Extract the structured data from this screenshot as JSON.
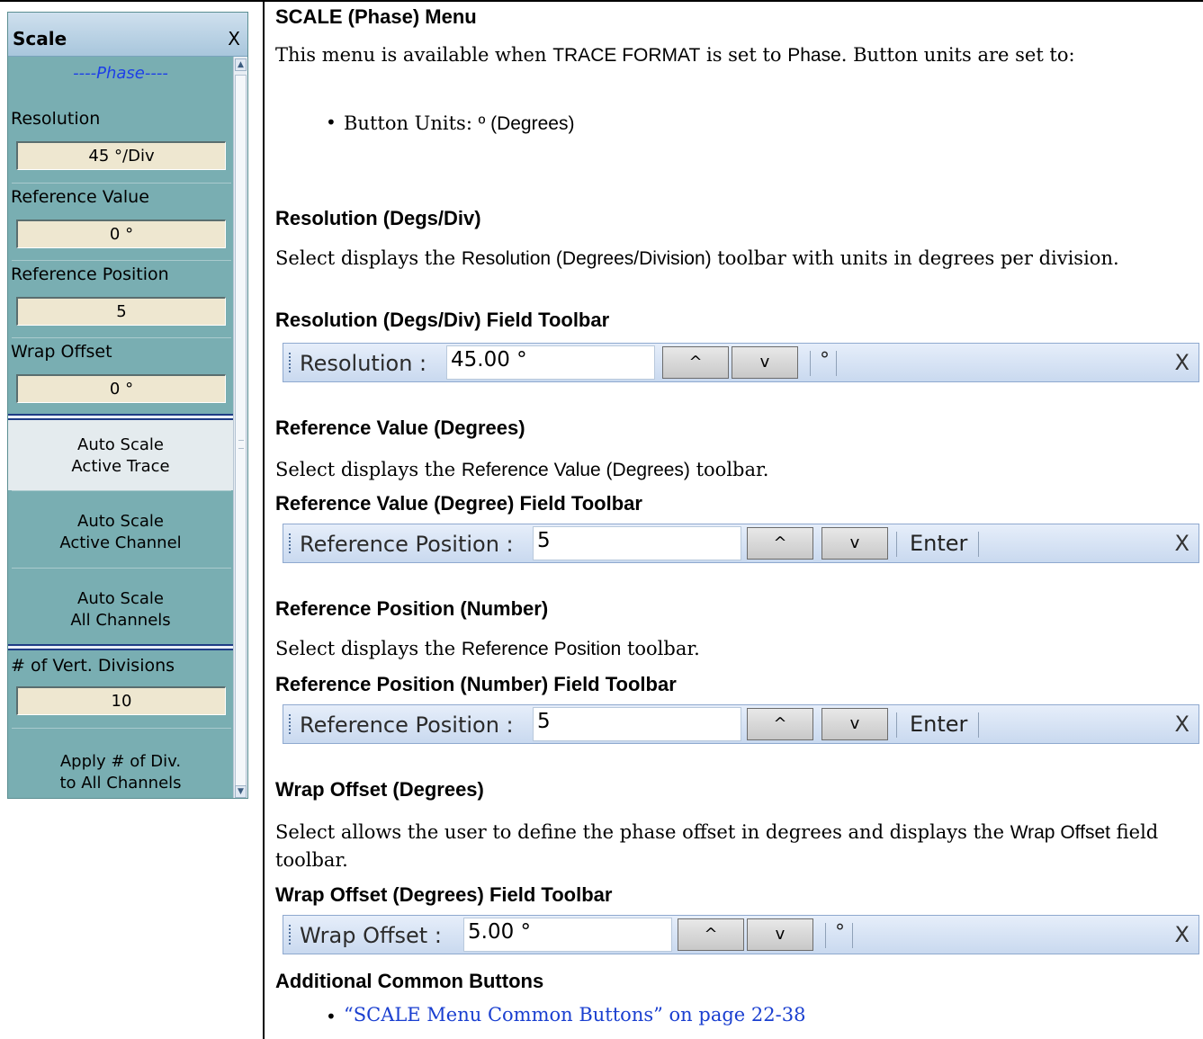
{
  "menu": {
    "title": "Scale",
    "close": "X",
    "section": "----Phase----",
    "resolution": {
      "label": "Resolution",
      "value": "45 °/Div"
    },
    "reference_value": {
      "label": "Reference Value",
      "value": "0 °"
    },
    "reference_position": {
      "label": "Reference Position",
      "value": "5"
    },
    "wrap_offset": {
      "label": "Wrap Offset",
      "value": "0 °"
    },
    "auto_scale_active_trace": [
      "Auto Scale",
      "Active Trace"
    ],
    "auto_scale_active_channel": [
      "Auto Scale",
      "Active Channel"
    ],
    "auto_scale_all_channels": [
      "Auto Scale",
      "All Channels"
    ],
    "vert_divisions": {
      "label": "# of Vert. Divisions",
      "value": "10"
    },
    "apply_div": [
      "Apply # of Div.",
      "to All Channels"
    ]
  },
  "doc": {
    "title": "SCALE (Phase) Menu",
    "intro": {
      "t1": "This menu is available when ",
      "t2": "TRACE FORMAT",
      "t3": " is set to ",
      "t4": "Phase",
      "t5": ". Button units are set to:"
    },
    "units_bullet": {
      "t1": "Button Units: ",
      "t2": "º (Degrees)"
    },
    "resolution_heading": "Resolution (Degs/Div)",
    "resolution_desc": {
      "t1": "Select displays the ",
      "t2": "Resolution (Degrees/Division)",
      "t3": " toolbar with units in degrees per division."
    },
    "resolution_toolbar_heading": "Resolution (Degs/Div) Field Toolbar",
    "refvalue_heading": "Reference Value (Degrees)",
    "refvalue_desc": {
      "t1": "Select displays the ",
      "t2": "Reference Value (Degrees)",
      "t3": " toolbar."
    },
    "refvalue_toolbar_heading": "Reference Value (Degree) Field Toolbar",
    "refpos_heading": "Reference Position (Number)",
    "refpos_desc": {
      "t1": "Select displays the ",
      "t2": "Reference Position",
      "t3": " toolbar."
    },
    "refpos_toolbar_heading": "Reference Position (Number) Field Toolbar",
    "wrap_heading": "Wrap Offset (Degrees)",
    "wrap_desc": {
      "t1": "Select allows the user to define the phase offset in degrees and displays the ",
      "t2": "Wrap Offset",
      "t3": " field toolbar."
    },
    "wrap_toolbar_heading": "Wrap Offset (Degrees) Field Toolbar",
    "common_heading": "Additional Common Buttons",
    "common_link": "“SCALE Menu Common Buttons” on page 22-38"
  },
  "toolbars": {
    "resolution": {
      "label": "Resolution  :",
      "value": "45.00 °",
      "up": "^",
      "down": "v",
      "unit": "°",
      "close": "X"
    },
    "refvalue": {
      "label": "Reference Position  :",
      "value": "5",
      "up": "^",
      "down": "v",
      "enter": "Enter",
      "close": "X"
    },
    "refpos": {
      "label": "Reference Position  :",
      "value": "5",
      "up": "^",
      "down": "v",
      "enter": "Enter",
      "close": "X"
    },
    "wrap": {
      "label": "Wrap Offset  :",
      "value": "5.00 °",
      "up": "^",
      "down": "v",
      "unit": "°",
      "close": "X"
    }
  }
}
